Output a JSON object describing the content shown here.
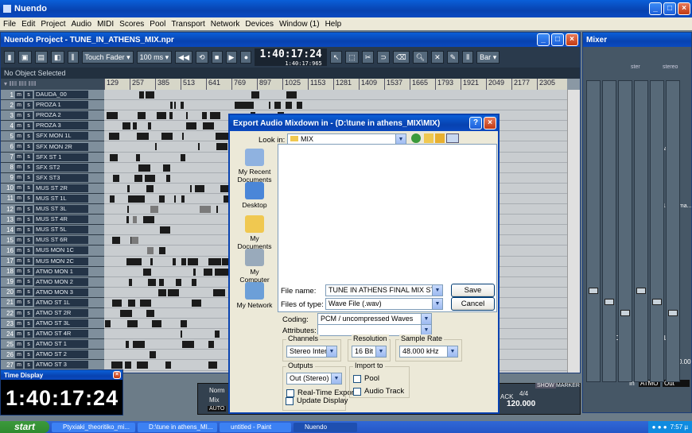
{
  "app": {
    "title": "Nuendo"
  },
  "menu": [
    "File",
    "Edit",
    "Project",
    "Audio",
    "MIDI",
    "Scores",
    "Pool",
    "Transport",
    "Network",
    "Devices",
    "Window (1)",
    "Help"
  ],
  "project": {
    "title": "Nuendo Project - TUNE_IN_ATHENS_MIX.npr",
    "touch_fader": "Touch Fader",
    "ms": "100 ms",
    "time_main": "1:40:17:24",
    "time_sub": "1:40:17:965",
    "bar_label": "Bar",
    "info": "No Object Selected",
    "ruler": [
      "129",
      "257",
      "385",
      "513",
      "641",
      "769",
      "897",
      "1025",
      "1153",
      "1281",
      "1409",
      "1537",
      "1665",
      "1793",
      "1921",
      "2049",
      "2177",
      "2305"
    ],
    "tracks": [
      {
        "n": "1",
        "name": "DAUDA_00"
      },
      {
        "n": "2",
        "name": "PROZA 1"
      },
      {
        "n": "3",
        "name": "PROZA 2"
      },
      {
        "n": "4",
        "name": "PROZA 3"
      },
      {
        "n": "5",
        "name": "SFX MON 1L"
      },
      {
        "n": "6",
        "name": "SFX MON 2R"
      },
      {
        "n": "7",
        "name": "SFX ST 1"
      },
      {
        "n": "8",
        "name": "SFX ST2"
      },
      {
        "n": "9",
        "name": "SFX ST3"
      },
      {
        "n": "10",
        "name": "MUS ST 2R"
      },
      {
        "n": "11",
        "name": "MUS ST 1L"
      },
      {
        "n": "12",
        "name": "MUS ST 3L"
      },
      {
        "n": "13",
        "name": "MUS ST 4R"
      },
      {
        "n": "14",
        "name": "MUS ST 5L"
      },
      {
        "n": "15",
        "name": "MUS ST 6R"
      },
      {
        "n": "16",
        "name": "MUS MON 1C"
      },
      {
        "n": "17",
        "name": "MUS MON 2C"
      },
      {
        "n": "18",
        "name": "ATMO MON 1"
      },
      {
        "n": "19",
        "name": "ATMO MON 2"
      },
      {
        "n": "20",
        "name": "ATMO MON 3"
      },
      {
        "n": "21",
        "name": "ATMO ST 1L"
      },
      {
        "n": "22",
        "name": "ATMO ST 2R"
      },
      {
        "n": "23",
        "name": "ATMO ST 3L"
      },
      {
        "n": "24",
        "name": "ATMO ST 4R"
      },
      {
        "n": "25",
        "name": "ATMO ST 1"
      },
      {
        "n": "26",
        "name": "ATMO ST 2"
      },
      {
        "n": "27",
        "name": "ATMO ST 3"
      }
    ],
    "track_m": "m",
    "track_s": "s"
  },
  "mixer": {
    "title": "Mixer",
    "ster": "ster",
    "stereo": "stereo",
    "c4": "C4",
    "plugin": "L1-Ultrama...er",
    "val": "0.00",
    "atmo": "ATMO",
    "out": "Out",
    "in": "In",
    "clip": "CLIP"
  },
  "time_display": {
    "title": "Time Display",
    "time": "1:40:17:24"
  },
  "transport": {
    "bpm": "120.000",
    "sig": "4/4",
    "show": "SHOW",
    "marker": "MARKER",
    "track_label": "ACK",
    "norm": "Norm",
    "mix": "Mix",
    "auto": "AUTO"
  },
  "dialog": {
    "title": "Export Audio Mixdown in - (D:\\tune in athens_MIX\\MIX)",
    "look_in_label": "Look in:",
    "look_in": "MIX",
    "places": [
      "My Recent Documents",
      "Desktop",
      "My Documents",
      "My Computer",
      "My Network"
    ],
    "file_name_label": "File name:",
    "file_name": "TUNE IN ATHENS FINAL MIX ST",
    "file_type_label": "Files of type:",
    "file_type": "Wave File (.wav)",
    "save": "Save",
    "cancel": "Cancel",
    "coding_label": "Coding:",
    "coding": "PCM / uncompressed Waves",
    "attributes_label": "Attributes:",
    "channels_label": "Channels",
    "channels": "Stereo Interleaved",
    "resolution_label": "Resolution",
    "resolution": "16 Bit",
    "sample_rate_label": "Sample Rate",
    "sample_rate": "48.000 kHz",
    "outputs_label": "Outputs",
    "outputs": "Out (Stereo)",
    "real_time": "Real-Time Export",
    "update_display": "Update Display",
    "import_label": "Import to",
    "pool": "Pool",
    "audio_track": "Audio Track"
  },
  "taskbar": {
    "start": "start",
    "tasks": [
      "Ptyxiaki_theoritiko_mi...",
      "D:\\tune in athens_MI...",
      "untitled - Paint",
      "Nuendo"
    ],
    "clock": "7:57 µ"
  }
}
